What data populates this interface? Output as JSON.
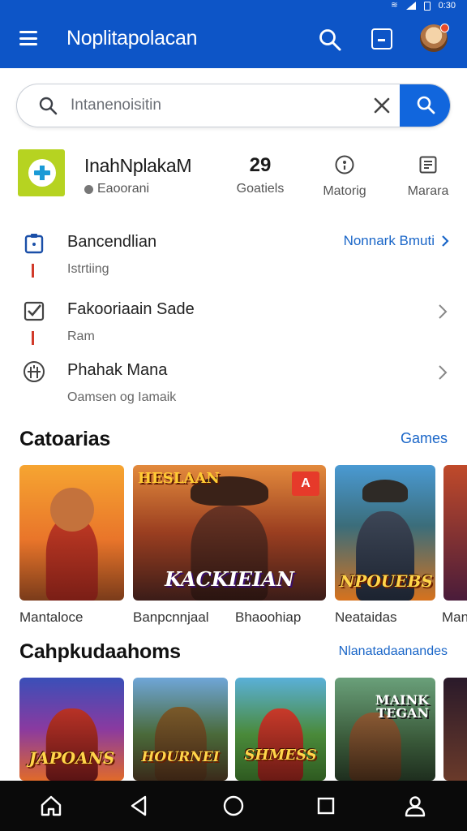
{
  "status_bar": {
    "time": "0:30"
  },
  "app_bar": {
    "title": "Noplitapolacan",
    "notification_count_color": "#e84a2a",
    "brand_color": "#0d55c7"
  },
  "search": {
    "placeholder": "Intanenoisitin",
    "clear_icon": "close-icon",
    "submit_icon": "search-icon"
  },
  "profile": {
    "name": "InahNplakaM",
    "location": "Eaoorani",
    "stats": [
      {
        "value": "29",
        "label": "Goatiels"
      },
      {
        "icon": "info-circle-icon",
        "label": "Matorig"
      },
      {
        "icon": "document-icon",
        "label": "Marara"
      }
    ]
  },
  "list": [
    {
      "icon": "clipboard-icon",
      "title": "Bancendlian",
      "subtitle": "Istrtiing",
      "action": "Nonnark Bmuti"
    },
    {
      "icon": "checkbox-icon",
      "title": "Fakooriaain Sade",
      "subtitle": "Ram"
    },
    {
      "icon": "gamepad-icon",
      "title": "Phahak Mana",
      "subtitle": "Oamsen og Iamaik"
    }
  ],
  "sections": [
    {
      "title": "Catoarias",
      "link": "Games",
      "cards": [
        {
          "label": "Mantaloce"
        },
        {
          "label": "Banpcnnjaal",
          "art_top": "HESLAAN",
          "art_bottom": "KACKIEIAN",
          "badge": "A"
        },
        {
          "label": "Bhaoohiap"
        },
        {
          "label": "Neataidas",
          "art_bottom": "NPOUEBS"
        },
        {
          "label": "Man"
        }
      ]
    },
    {
      "title": "Cahpkudaahoms",
      "link": "Nlanatadaanandes",
      "cards": [
        {
          "art_bottom": "JAPOANS"
        },
        {
          "art_bottom": "HOURNEI"
        },
        {
          "art_bottom": "SHMESS"
        },
        {
          "art_top": "MAINK TEGAN"
        },
        {}
      ]
    }
  ],
  "bottom_nav": [
    "home-icon",
    "back-icon",
    "home-circle-icon",
    "recents-icon",
    "profile-icon"
  ]
}
